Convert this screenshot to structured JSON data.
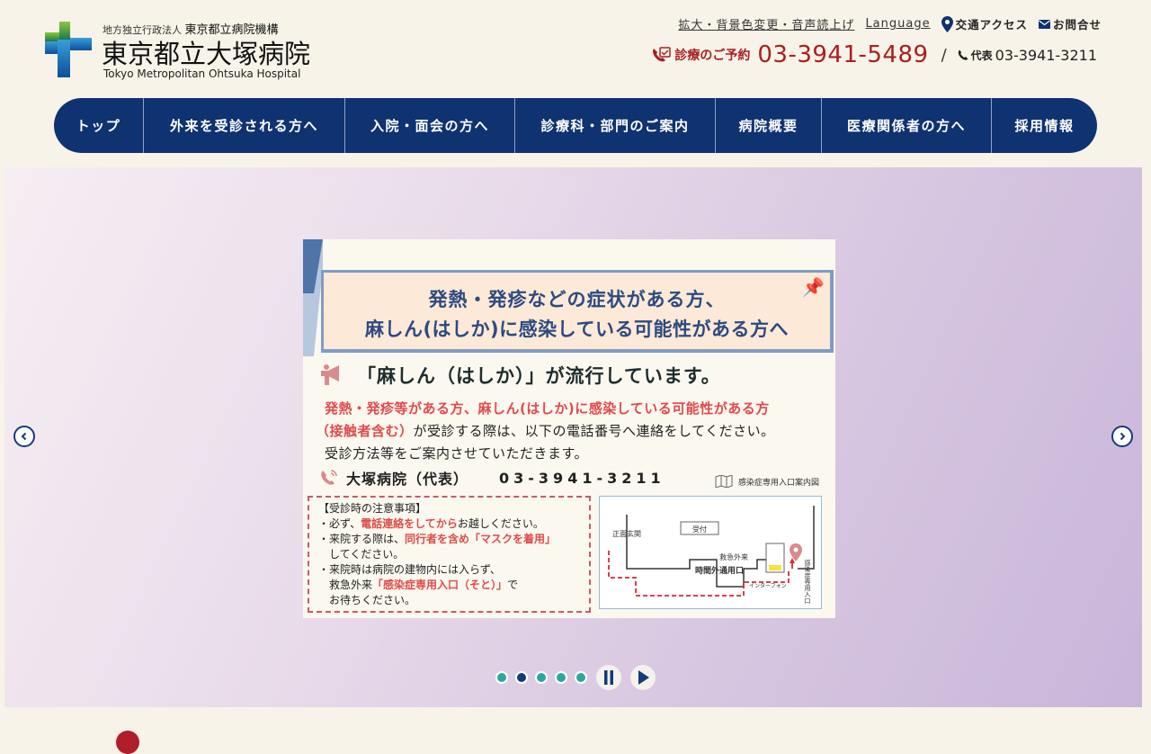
{
  "header": {
    "org_prefix": "地方独立行政法人",
    "org_name": "東京都立病院機構",
    "hospital_name": "東京都立大塚病院",
    "hospital_name_en": "Tokyo Metropolitan Ohtsuka Hospital",
    "util_links": {
      "accessibility": "拡大・背景色変更・音声読上げ",
      "language": "Language",
      "access": "交通アクセス",
      "contact": "お問合せ"
    },
    "tel": {
      "reserve_label": "診療のご予約",
      "reserve_number": "03-3941-5489",
      "separator": "/",
      "main_label": "代表",
      "main_number": "03-3941-3211"
    }
  },
  "nav": {
    "items": [
      {
        "label": "トップ"
      },
      {
        "label": "外来を受診される方へ"
      },
      {
        "label": "入院・面会の方へ"
      },
      {
        "label": "診療科・部門のご案内"
      },
      {
        "label": "病院概要"
      },
      {
        "label": "医療関係者の方へ"
      },
      {
        "label": "採用情報"
      }
    ]
  },
  "slide": {
    "banner_line1": "発熱・発疹などの症状がある方、",
    "banner_line2": "麻しん(はしか)に感染している可能性がある方へ",
    "headline": "「麻しん（はしか）」が流行しています。",
    "red_line1": "発熱・発疹等がある方、麻しん(はしか)に感染している可能性がある方",
    "red_line2": "（接触者含む）",
    "line2_rest": "が受診する際は、以下の電話番号へ連絡をしてください。",
    "line3": "受診方法等をご案内させていただきます。",
    "tel_label": "大塚病院（代表）",
    "tel_number": "03-3941-3211",
    "map_title": "感染症専用入口案内図",
    "notice": {
      "title": "【受診時の注意事項】",
      "l1a": "・必ず、",
      "l1b": "電話連絡をしてから",
      "l1c": "お越しください。",
      "l2a": "・来院する際は、",
      "l2b": "同行者を含め「マスクを着用」",
      "l2c": "してください。",
      "l3": "・来院時は病院の建物内には入らず、",
      "l4a": "救急外来",
      "l4b": "「感染症専用入口（そと）」",
      "l4c": "で",
      "l5": "お待ちください。"
    },
    "map_labels": {
      "front": "正面玄関",
      "after_hours": "時間外通用口",
      "reception": "受付",
      "emergency": "救急外来",
      "interphone": "インターフォン",
      "entrance": "感染症専用入口"
    }
  },
  "carousel": {
    "dots": 5,
    "active_index": 1
  },
  "colors": {
    "navy": "#0f3270",
    "reserve_red": "#a8201f",
    "dot_teal": "#2aa89f",
    "background": "#f7f3e8"
  }
}
